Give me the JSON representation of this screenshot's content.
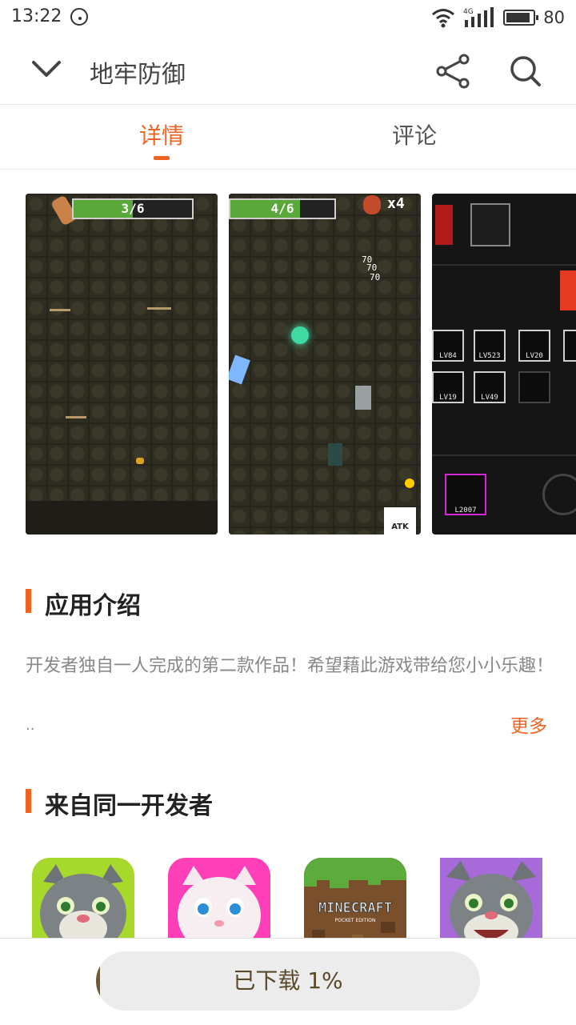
{
  "status_bar": {
    "time": "13:22",
    "battery": "80",
    "network": "4G"
  },
  "header": {
    "title": "地牢防御"
  },
  "tabs": [
    {
      "label": "详情"
    },
    {
      "label": "评论"
    }
  ],
  "screenshots": [
    {
      "hp": "3/6"
    },
    {
      "hp": "4/6",
      "multiplier": "x4",
      "damage": [
        "70",
        "70",
        "70"
      ],
      "atk": "ATK"
    },
    {
      "levels": [
        "LV84",
        "LV523",
        "LV20",
        "LV19",
        "LV49",
        "L2007"
      ]
    }
  ],
  "intro": {
    "heading": "应用介绍",
    "text": "开发者独自一人完成的第二款作品！希望藉此游戏带给您小小乐趣！",
    "ellipsis": "..",
    "more": "更多"
  },
  "related": {
    "heading": "来自同一开发者",
    "minecraft_logo": "MINECRAFT",
    "minecraft_edition": "POCKET EDITION"
  },
  "download": {
    "label": "已下载 1%",
    "progress": 0.01
  },
  "colors": {
    "accent": "#f06422"
  }
}
